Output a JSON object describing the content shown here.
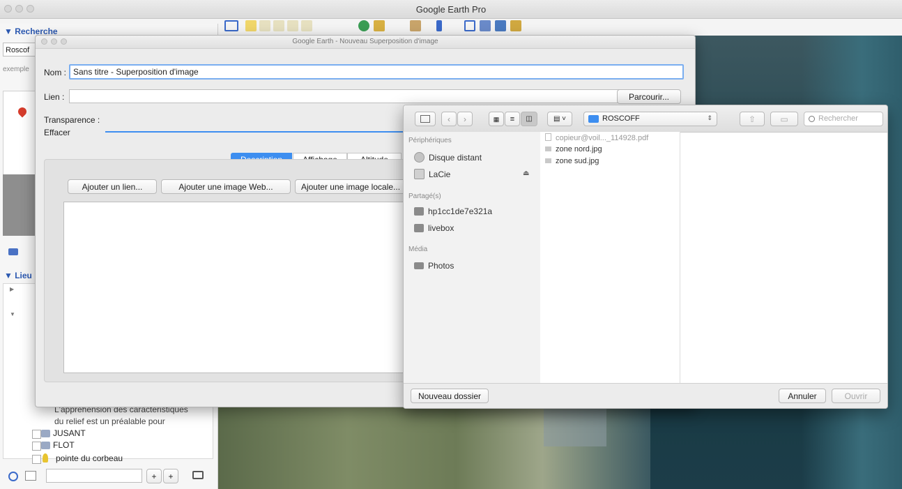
{
  "app": {
    "title": "Google Earth Pro"
  },
  "search_panel": {
    "header": "▼ Recherche",
    "query": "Roscof",
    "hint": "exemple"
  },
  "places_panel": {
    "header": "▼ Lieu",
    "description_line1": "L'appréhension des caractéristiques",
    "description_line2": "du relief est un préalable pour",
    "items": [
      {
        "label": "JUSANT"
      },
      {
        "label": "FLOT"
      },
      {
        "label": "pointe du corbeau"
      }
    ],
    "add_label": "+",
    "remove_label": "+"
  },
  "overlay_dialog": {
    "title": "Google Earth - Nouveau Superposition d'image",
    "name_label": "Nom :",
    "name_value": "Sans titre - Superposition d'image",
    "link_label": "Lien :",
    "link_value": "",
    "browse_label": "Parcourir...",
    "transparency_label": "Transparence :",
    "clear_label": "Effacer",
    "tabs": [
      "Description",
      "Affichage",
      "Altitude"
    ],
    "add_link_label": "Ajouter un lien...",
    "add_web_image_label": "Ajouter une image Web...",
    "add_local_image_label": "Ajouter une image locale..."
  },
  "file_dialog": {
    "location": "ROSCOFF",
    "search_placeholder": "Rechercher",
    "sidebar": {
      "devices_header": "Périphériques",
      "devices": [
        "Disque distant",
        "LaCie"
      ],
      "shared_header": "Partagé(s)",
      "shared": [
        "hp1cc1de7e321a",
        "livebox"
      ],
      "media_header": "Média",
      "media": [
        "Photos"
      ]
    },
    "files": [
      "copieur@voil..._114928.pdf",
      "zone nord.jpg",
      "zone sud.jpg"
    ],
    "new_folder_label": "Nouveau dossier",
    "cancel_label": "Annuler",
    "open_label": "Ouvrir"
  },
  "colors": {
    "accent": "#3d8ef0",
    "selection": "#b3d4fc",
    "ocean": "#1c3d49"
  }
}
